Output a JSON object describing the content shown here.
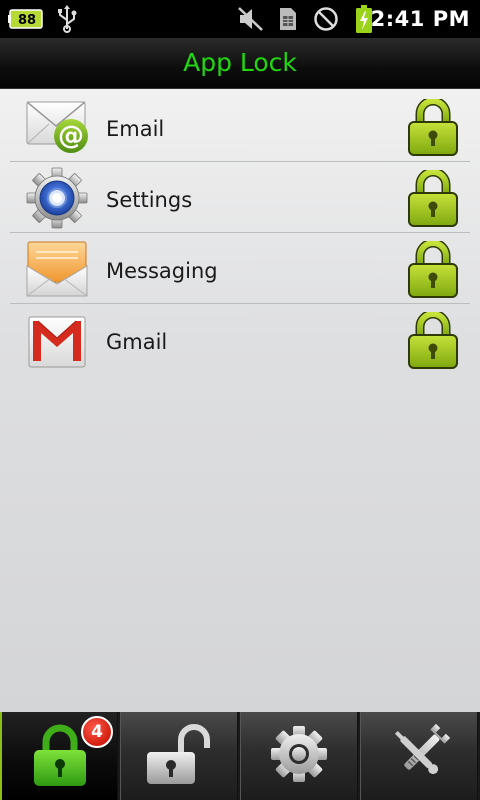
{
  "status_bar": {
    "battery_level": "88",
    "time": "2:41 PM",
    "icons": [
      "battery-icon",
      "usb-icon",
      "mute-icon",
      "sim-card-icon",
      "no-signal-icon",
      "charging-battery-icon"
    ]
  },
  "header": {
    "title": "App Lock"
  },
  "apps": [
    {
      "name": "Email",
      "icon": "email-icon",
      "locked": true
    },
    {
      "name": "Settings",
      "icon": "settings-icon",
      "locked": true
    },
    {
      "name": "Messaging",
      "icon": "messaging-icon",
      "locked": true
    },
    {
      "name": "Gmail",
      "icon": "gmail-icon",
      "locked": true
    }
  ],
  "tabs": [
    {
      "id": "locked",
      "icon": "locked-padlock-icon",
      "badge": "4",
      "active": true
    },
    {
      "id": "unlocked",
      "icon": "unlocked-padlock-icon",
      "active": false
    },
    {
      "id": "settings",
      "icon": "gear-icon",
      "active": false
    },
    {
      "id": "tools",
      "icon": "tools-icon",
      "active": false
    }
  ],
  "colors": {
    "title_green": "#22d611",
    "lock_green": "#9bc41a",
    "badge_red": "#d21d10"
  }
}
